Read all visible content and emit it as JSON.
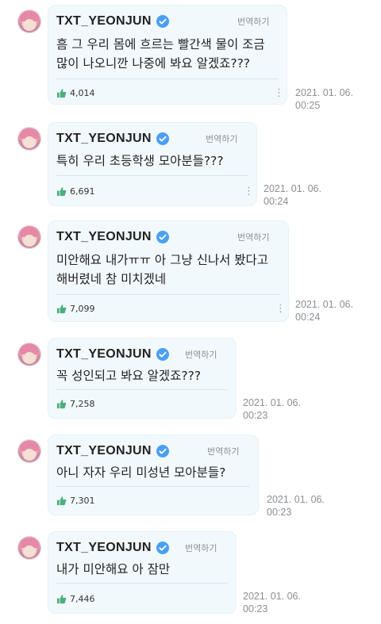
{
  "colors": {
    "bubble_bg": "#f1f9fd",
    "verified_badge": "#4a9ff5",
    "like_icon": "#4caf7d",
    "timestamp": "#8b8f93"
  },
  "posts": [
    {
      "author": "TXT_YEONJUN",
      "translate": "번역하기",
      "text": "흠 그 우리 몸에 흐르는 빨간색 물이 조금 많이 나오니깐 나중에 봐요 알겠죠???",
      "likes": "4,014",
      "date": "2021. 01. 06.",
      "time": "00:25"
    },
    {
      "author": "TXT_YEONJUN",
      "translate": "번역하기",
      "text": "특히 우리 초등학생 모아분들???",
      "likes": "6,691",
      "date": "2021. 01. 06.",
      "time": "00:24"
    },
    {
      "author": "TXT_YEONJUN",
      "translate": "번역하기",
      "text": "미안해요 내가ㅠㅠ 아 그냥 신나서 봤다고 해버렸네 참 미치겠네",
      "likes": "7,099",
      "date": "2021. 01. 06.",
      "time": "00:24"
    },
    {
      "author": "TXT_YEONJUN",
      "translate": "번역하기",
      "text": "꼭 성인되고 봐요 알겠죠???",
      "likes": "7,258",
      "date": "2021. 01. 06.",
      "time": "00:23"
    },
    {
      "author": "TXT_YEONJUN",
      "translate": "번역하기",
      "text": "아니 자자 우리 미성년 모아분들?",
      "likes": "7,301",
      "date": "2021. 01. 06.",
      "time": "00:23"
    },
    {
      "author": "TXT_YEONJUN",
      "translate": "번역하기",
      "text": "내가 미안해요 아 잠만",
      "likes": "7,446",
      "date": "2021. 01. 06.",
      "time": "00:23"
    }
  ]
}
